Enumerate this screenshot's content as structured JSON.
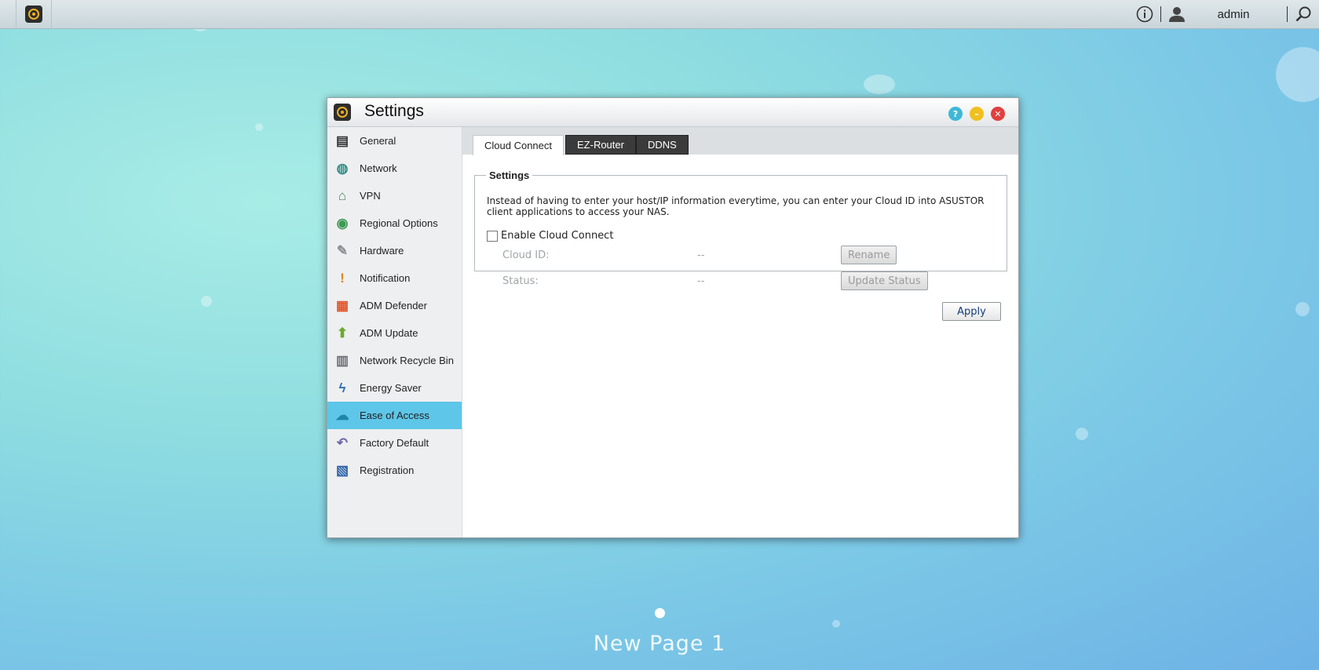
{
  "topbar": {
    "info_icon": "info-icon",
    "user_icon": "user-icon",
    "username": "admin",
    "search_icon": "search-icon"
  },
  "window": {
    "title": "Settings",
    "help_icon": "help-icon",
    "minimize_icon": "minimize-icon",
    "close_icon": "close-icon"
  },
  "sidebar": {
    "items": [
      {
        "label": "General",
        "icon": "server-icon",
        "color": "#333333"
      },
      {
        "label": "Network",
        "icon": "globe-icon",
        "color": "#2f8f86"
      },
      {
        "label": "VPN",
        "icon": "vpn-house-icon",
        "color": "#3e8a5c"
      },
      {
        "label": "Regional Options",
        "icon": "globe-pin-icon",
        "color": "#3c9a54"
      },
      {
        "label": "Hardware",
        "icon": "wrench-icon",
        "color": "#8a8f94"
      },
      {
        "label": "Notification",
        "icon": "exclamation-icon",
        "color": "#d6881c"
      },
      {
        "label": "ADM Defender",
        "icon": "firewall-icon",
        "color": "#e2562a"
      },
      {
        "label": "ADM Update",
        "icon": "arrow-up-icon",
        "color": "#6aab2c"
      },
      {
        "label": "Network Recycle Bin",
        "icon": "trash-icon",
        "color": "#6b6f73"
      },
      {
        "label": "Energy Saver",
        "icon": "lightning-icon",
        "color": "#2d6fb8"
      },
      {
        "label": "Ease of Access",
        "icon": "cloud-upload-icon",
        "color": "#1f86a8"
      },
      {
        "label": "Factory Default",
        "icon": "undo-icon",
        "color": "#6b6aa8"
      },
      {
        "label": "Registration",
        "icon": "clipboard-icon",
        "color": "#2c63a8"
      }
    ],
    "active_index": 10
  },
  "tabs": [
    {
      "label": "Cloud Connect"
    },
    {
      "label": "EZ-Router"
    },
    {
      "label": "DDNS"
    }
  ],
  "settings_group": {
    "legend": "Settings",
    "description": "Instead of having to enter your host/IP information everytime, you can enter your Cloud ID into ASUSTOR client applications to access your NAS.",
    "enable_label": "Enable Cloud Connect",
    "enable_checked": false,
    "cloud_id_label": "Cloud ID:",
    "cloud_id_value": "--",
    "rename_label": "Rename",
    "status_label": "Status:",
    "status_value": "--",
    "update_status_label": "Update Status"
  },
  "apply_label": "Apply",
  "desktop": {
    "page_name": "New Page 1"
  }
}
